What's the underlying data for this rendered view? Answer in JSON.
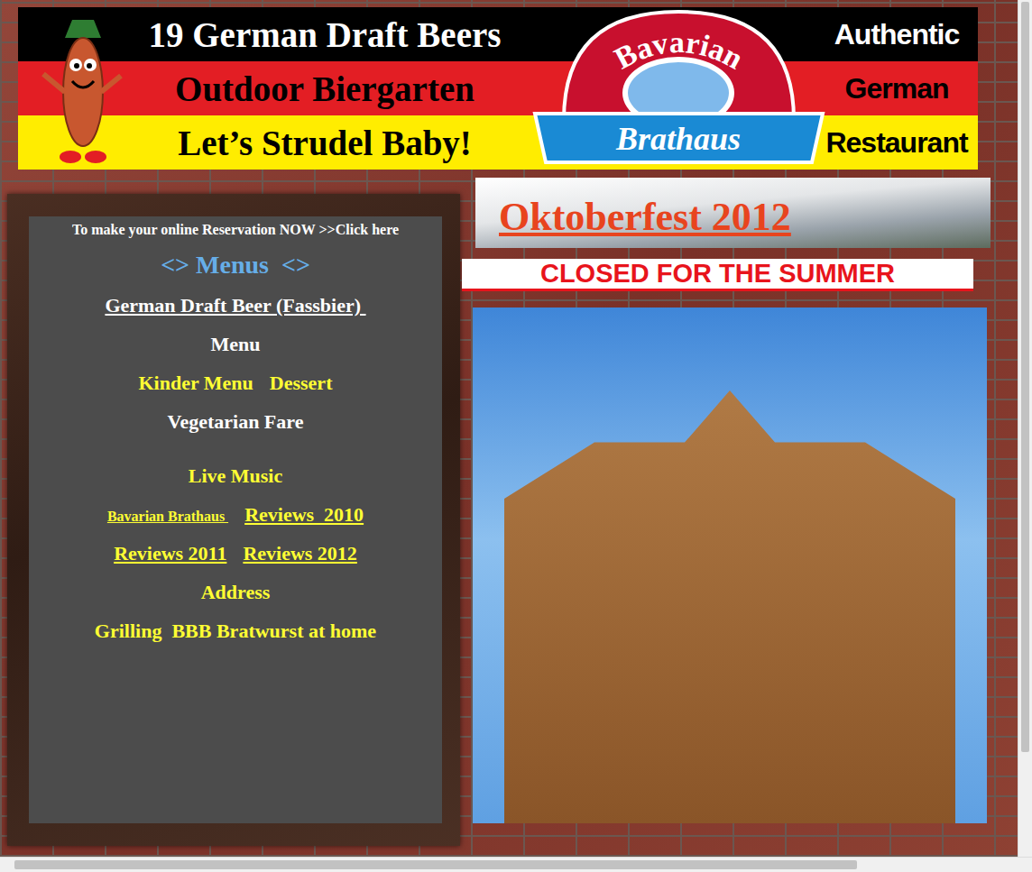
{
  "banner": {
    "lines": [
      {
        "text": "19 German Draft Beers",
        "right": "Authentic",
        "color": "#000000",
        "ink": "#ffffff"
      },
      {
        "text": "Outdoor Biergarten",
        "right": "German",
        "color": "#e31e24",
        "ink": "#000000"
      },
      {
        "text": "Let’s Strudel Baby!",
        "right": "Restaurant",
        "color": "#ffed00",
        "ink": "#000000"
      }
    ],
    "logo": {
      "top": "Bavarian",
      "bottom": "Brathaus"
    }
  },
  "sidebar": {
    "reservation": "To make your online Reservation NOW >>Click here",
    "heading": "<> Menus  <>",
    "groups": [
      {
        "rows": [
          {
            "links": [
              {
                "text": "German Draft Beer (Fassbier) ",
                "color": "#ffffff",
                "underlined": true,
                "kind": "normal"
              }
            ]
          },
          {
            "links": [
              {
                "text": "Menu",
                "color": "#ffffff",
                "underlined": false,
                "kind": "normal"
              }
            ]
          },
          {
            "links": [
              {
                "text": "Kinder Menu",
                "color": "#ffff33",
                "underlined": false,
                "kind": "normal"
              },
              {
                "text": "Dessert",
                "color": "#ffff33",
                "underlined": false,
                "kind": "normal"
              }
            ]
          },
          {
            "links": [
              {
                "text": "Vegetarian Fare",
                "color": "#ffffff",
                "underlined": false,
                "kind": "normal"
              }
            ]
          }
        ]
      },
      {
        "rows": [
          {
            "links": [
              {
                "text": "Live Music",
                "color": "#ffff33",
                "underlined": false,
                "kind": "normal"
              }
            ]
          },
          {
            "links": [
              {
                "text": "Bavarian Brathaus ",
                "color": "#ffff33",
                "underlined": true,
                "kind": "small"
              },
              {
                "text": "Reviews  2010",
                "color": "#ffff33",
                "underlined": true,
                "kind": "normal"
              }
            ]
          },
          {
            "links": [
              {
                "text": "Reviews 2011",
                "color": "#ffff33",
                "underlined": true,
                "kind": "normal"
              },
              {
                "text": "Reviews 2012",
                "color": "#ffff33",
                "underlined": true,
                "kind": "normal"
              }
            ]
          },
          {
            "links": [
              {
                "text": "Address",
                "color": "#ffff33",
                "underlined": false,
                "kind": "normal"
              }
            ]
          },
          {
            "links": [
              {
                "text": "Grilling  BBB Bratwurst at home",
                "color": "#ffff33",
                "underlined": false,
                "kind": "normal"
              }
            ]
          }
        ]
      }
    ]
  },
  "event": {
    "title": "Oktoberfest 2012"
  },
  "notice": "CLOSED FOR THE SUMMER",
  "scrollbars": {
    "vertical": {
      "level": 0.88
    },
    "horizontal": {
      "level": 0.84
    }
  }
}
